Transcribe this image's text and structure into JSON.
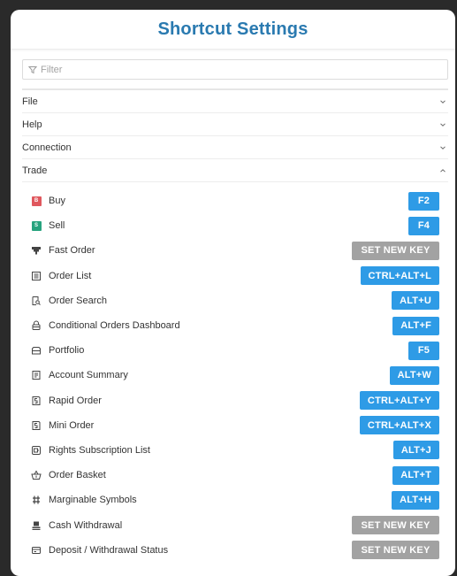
{
  "title": "Shortcut Settings",
  "filter": {
    "placeholder": "Filter",
    "value": ""
  },
  "sections": [
    {
      "label": "File",
      "expanded": false
    },
    {
      "label": "Help",
      "expanded": false
    },
    {
      "label": "Connection",
      "expanded": false
    },
    {
      "label": "Trade",
      "expanded": true
    }
  ],
  "items": [
    {
      "label": "Buy",
      "key": "F2",
      "icon": "buy-badge-icon",
      "badge": "B"
    },
    {
      "label": "Sell",
      "key": "F4",
      "icon": "sell-badge-icon",
      "badge": "S"
    },
    {
      "label": "Fast Order",
      "key": "SET NEW KEY",
      "icon": "fast-order-icon",
      "unset": true
    },
    {
      "label": "Order List",
      "key": "CTRL+ALT+L",
      "icon": "order-list-icon"
    },
    {
      "label": "Order Search",
      "key": "ALT+U",
      "icon": "order-search-icon"
    },
    {
      "label": "Conditional Orders Dashboard",
      "key": "ALT+F",
      "icon": "conditional-orders-icon"
    },
    {
      "label": "Portfolio",
      "key": "F5",
      "icon": "portfolio-icon"
    },
    {
      "label": "Account Summary",
      "key": "ALT+W",
      "icon": "account-summary-icon"
    },
    {
      "label": "Rapid Order",
      "key": "CTRL+ALT+Y",
      "icon": "rapid-order-icon"
    },
    {
      "label": "Mini Order",
      "key": "CTRL+ALT+X",
      "icon": "mini-order-icon"
    },
    {
      "label": "Rights Subscription List",
      "key": "ALT+J",
      "icon": "rights-subscription-icon"
    },
    {
      "label": "Order Basket",
      "key": "ALT+T",
      "icon": "order-basket-icon"
    },
    {
      "label": "Marginable Symbols",
      "key": "ALT+H",
      "icon": "marginable-symbols-icon"
    },
    {
      "label": "Cash Withdrawal",
      "key": "SET NEW KEY",
      "icon": "cash-withdrawal-icon",
      "unset": true
    },
    {
      "label": "Deposit / Withdrawal Status",
      "key": "SET NEW KEY",
      "icon": "deposit-withdrawal-status-icon",
      "unset": true
    }
  ],
  "colors": {
    "title": "#2a7ab0",
    "key_button": "#2e9be6",
    "unset_button": "#a2a2a2",
    "buy_badge": "#e0585e",
    "sell_badge": "#27a37e"
  }
}
